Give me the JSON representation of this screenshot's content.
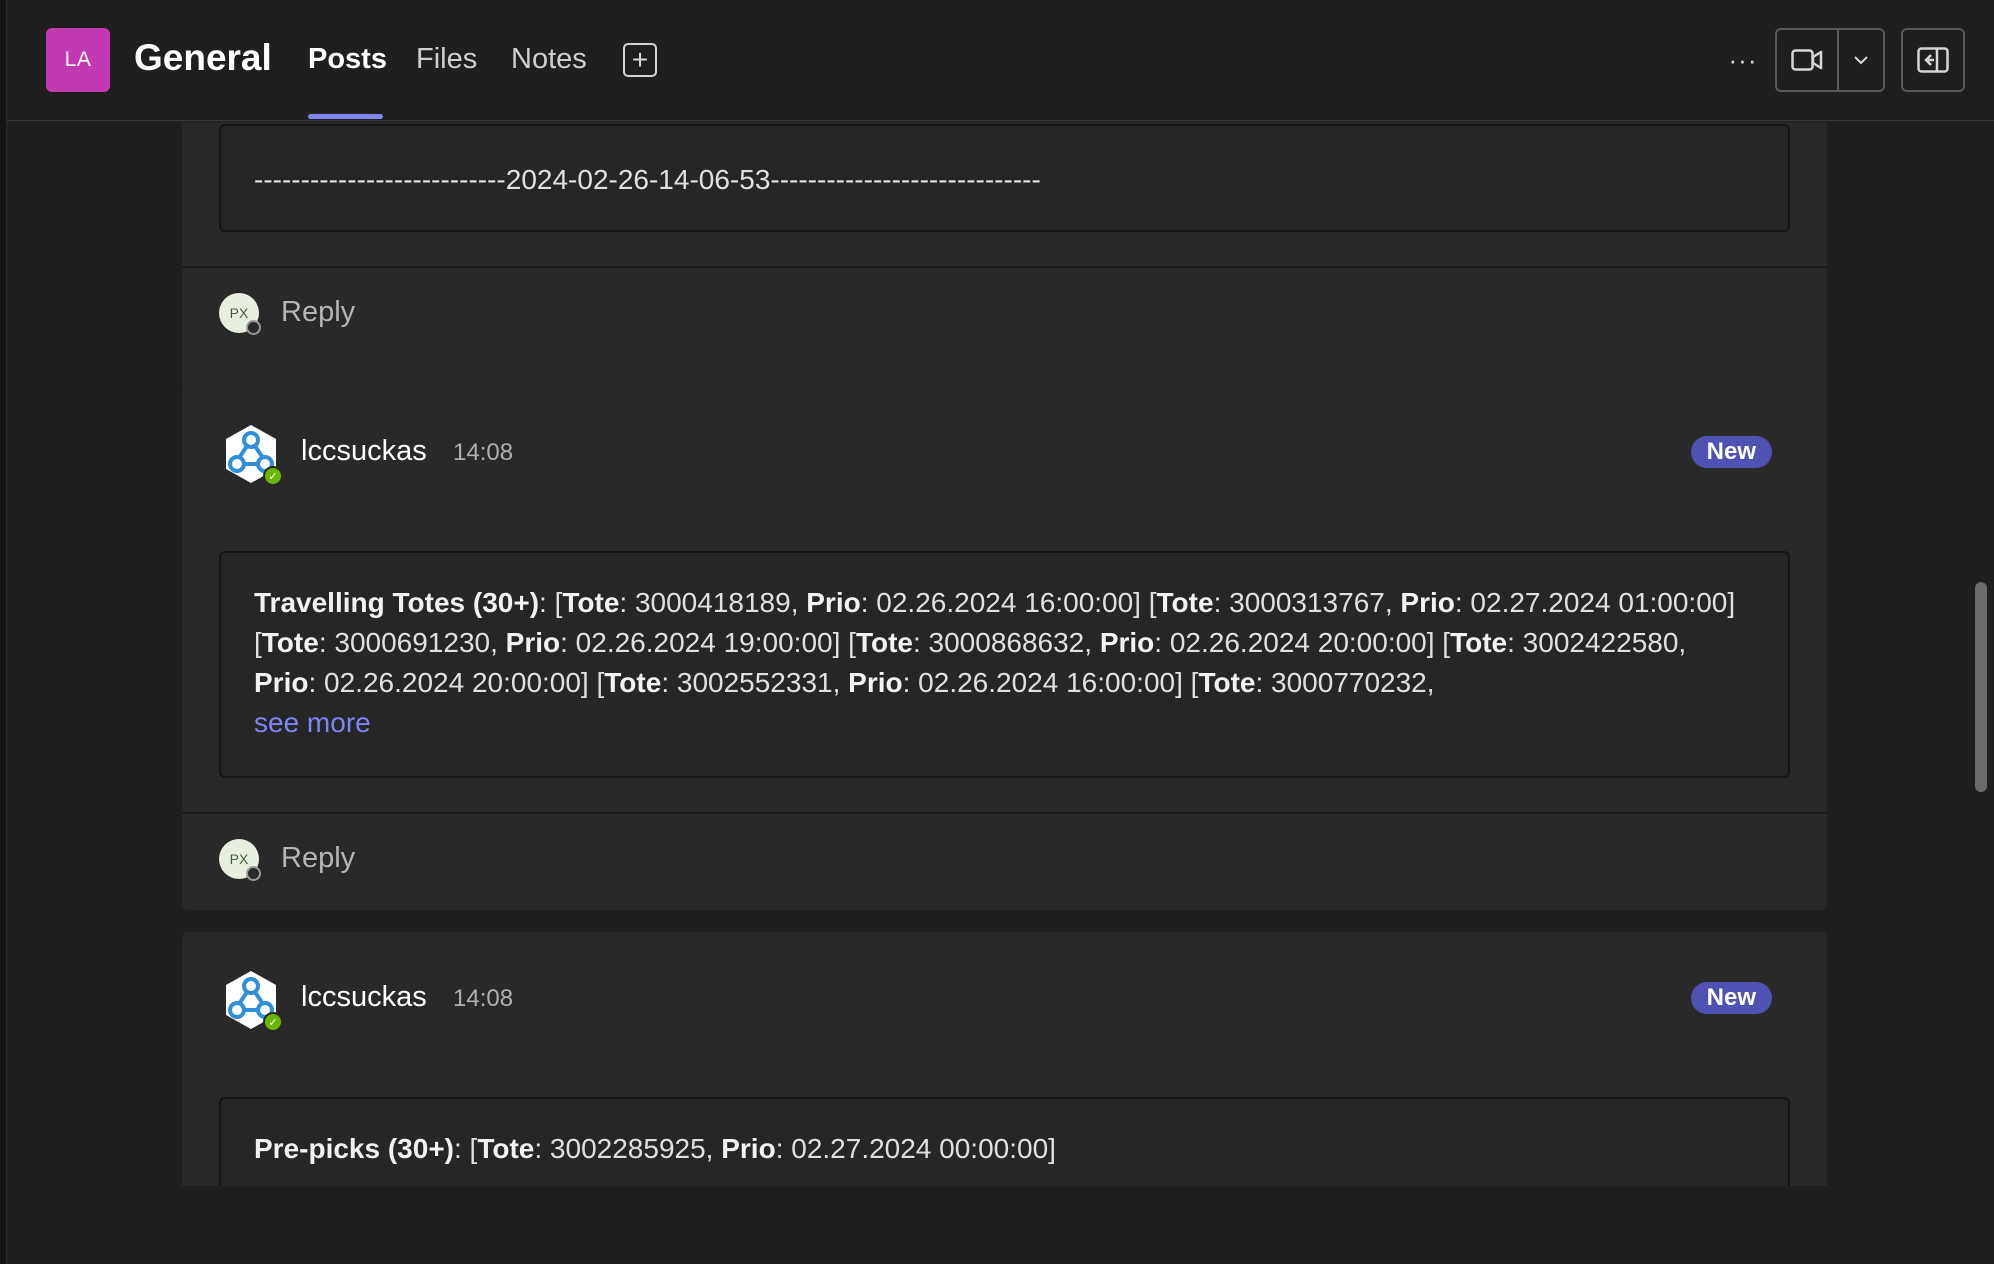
{
  "header": {
    "team_initials": "LA",
    "team_color": "#c239b3",
    "channel_name": "General",
    "tabs": [
      {
        "label": "Posts",
        "active": true
      },
      {
        "label": "Files",
        "active": false
      },
      {
        "label": "Notes",
        "active": false
      }
    ],
    "add_tab_icon": "plus-square-icon",
    "more_icon": "more-horizontal-icon",
    "more_glyph": "···",
    "meet_icon": "video-camera-icon",
    "meet_dropdown_icon": "chevron-down-icon",
    "panel_icon": "open-side-panel-icon"
  },
  "posts": [
    {
      "body_text": "---------------------------2024-02-26-14-06-53-----------------------------",
      "reply_avatar_initials": "PX",
      "reply_label": "Reply"
    },
    {
      "author": "lccsuckas",
      "time": "14:08",
      "badge": "New",
      "body_segments": [
        {
          "text": "Travelling Totes (30+)",
          "bold": true
        },
        {
          "text": ": [",
          "bold": false
        },
        {
          "text": "Tote",
          "bold": true
        },
        {
          "text": ": 3000418189, ",
          "bold": false
        },
        {
          "text": "Prio",
          "bold": true
        },
        {
          "text": ": 02.26.2024 16:00:00] [",
          "bold": false
        },
        {
          "text": "Tote",
          "bold": true
        },
        {
          "text": ": 3000313767, ",
          "bold": false
        },
        {
          "text": "Prio",
          "bold": true
        },
        {
          "text": ": 02.27.2024 01:00:00] [",
          "bold": false
        },
        {
          "text": "Tote",
          "bold": true
        },
        {
          "text": ": 3000691230, ",
          "bold": false
        },
        {
          "text": "Prio",
          "bold": true
        },
        {
          "text": ": 02.26.2024 19:00:00] [",
          "bold": false
        },
        {
          "text": "Tote",
          "bold": true
        },
        {
          "text": ": 3000868632, ",
          "bold": false
        },
        {
          "text": "Prio",
          "bold": true
        },
        {
          "text": ": 02.26.2024 20:00:00] [",
          "bold": false
        },
        {
          "text": "Tote",
          "bold": true
        },
        {
          "text": ": 3002422580, ",
          "bold": false
        },
        {
          "text": "Prio",
          "bold": true
        },
        {
          "text": ": 02.26.2024 20:00:00] [",
          "bold": false
        },
        {
          "text": "Tote",
          "bold": true
        },
        {
          "text": ": 3002552331, ",
          "bold": false
        },
        {
          "text": "Prio",
          "bold": true
        },
        {
          "text": ": 02.26.2024 16:00:00] [",
          "bold": false
        },
        {
          "text": "Tote",
          "bold": true
        },
        {
          "text": ": 3000770232,",
          "bold": false
        }
      ],
      "see_more": "see more",
      "reply_avatar_initials": "PX",
      "reply_label": "Reply"
    },
    {
      "author": "lccsuckas",
      "time": "14:08",
      "badge": "New",
      "body_segments": [
        {
          "text": "Pre-picks (30+)",
          "bold": true
        },
        {
          "text": ": [",
          "bold": false
        },
        {
          "text": "Tote",
          "bold": true
        },
        {
          "text": ": 3002285925, ",
          "bold": false
        },
        {
          "text": "Prio",
          "bold": true
        },
        {
          "text": ": 02.27.2024 00:00:00]",
          "bold": false
        }
      ]
    }
  ],
  "colors": {
    "accent": "#7f85f5",
    "new_badge": "#4f52b2",
    "presence_available": "#6bb700"
  }
}
